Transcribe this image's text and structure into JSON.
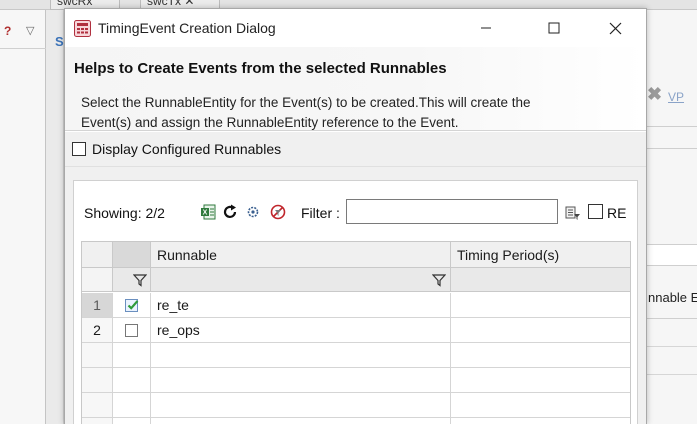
{
  "background": {
    "tabs": [
      "swcRx",
      "swcTx"
    ],
    "left_letter": "S",
    "right_link": "VP",
    "right_label": "nnable E"
  },
  "dialog": {
    "title": "TimingEvent Creation Dialog",
    "header_title": "Helps to Create Events from the selected Runnables",
    "header_description": "Select the RunnableEntity for the Event(s) to be created.This will create the Event(s) and assign the RunnableEntity reference to the Event.",
    "display_configured_label": "Display Configured Runnables",
    "display_configured_checked": false
  },
  "toolbar": {
    "showing": "Showing: 2/2",
    "icons": [
      "excel-export-icon",
      "refresh-icon",
      "settings-icon",
      "clear-filter-icon",
      "filter-options-icon"
    ],
    "filter_label": "Filter :",
    "filter_value": "",
    "re_label": "RE",
    "re_checked": false
  },
  "table": {
    "columns": [
      "Runnable",
      "Timing Period(s)"
    ],
    "rows": [
      {
        "num": "1",
        "checked": true,
        "runnable": "re_te",
        "period": "",
        "selected": true
      },
      {
        "num": "2",
        "checked": false,
        "runnable": "re_ops",
        "period": "",
        "selected": false
      }
    ]
  },
  "colors": {
    "selected_row_header": "#d7d7d7",
    "check_accent": "#2e9b3a",
    "icon_red": "#c0262c"
  }
}
